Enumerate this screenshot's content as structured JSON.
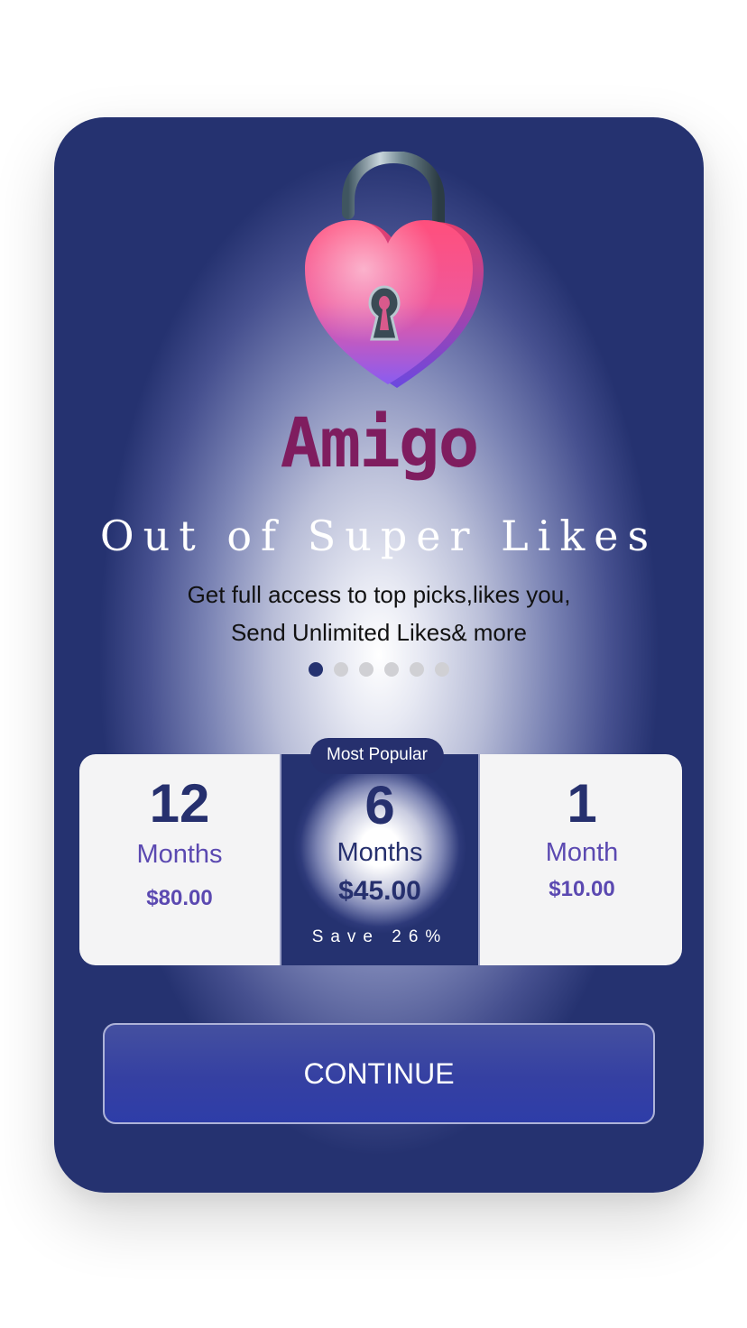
{
  "app": {
    "brand_name": "Amigo"
  },
  "header": {
    "title": "Out of Super Likes",
    "subtitle_line1": "Get full access to top picks,likes you,",
    "subtitle_line2": "Send Unlimited Likes& more"
  },
  "carousel": {
    "total_pages": 6,
    "active_index": 0
  },
  "plans": {
    "badge_label": "Most Popular",
    "items": [
      {
        "duration": "12",
        "unit": "Months",
        "price": "$80.00"
      },
      {
        "duration": "6",
        "unit": "Months",
        "price": "$45.00",
        "note": "Save 26%"
      },
      {
        "duration": "1",
        "unit": "Month",
        "price": "$10.00"
      }
    ],
    "selected_index": 1
  },
  "actions": {
    "continue_label": "CONTINUE"
  },
  "colors": {
    "card_navy": "#253270",
    "brand": "#7f1d5f",
    "plan_accent": "#5b49b1",
    "button": "#3540a2"
  },
  "icons": {
    "hero": "heart-padlock-icon"
  }
}
